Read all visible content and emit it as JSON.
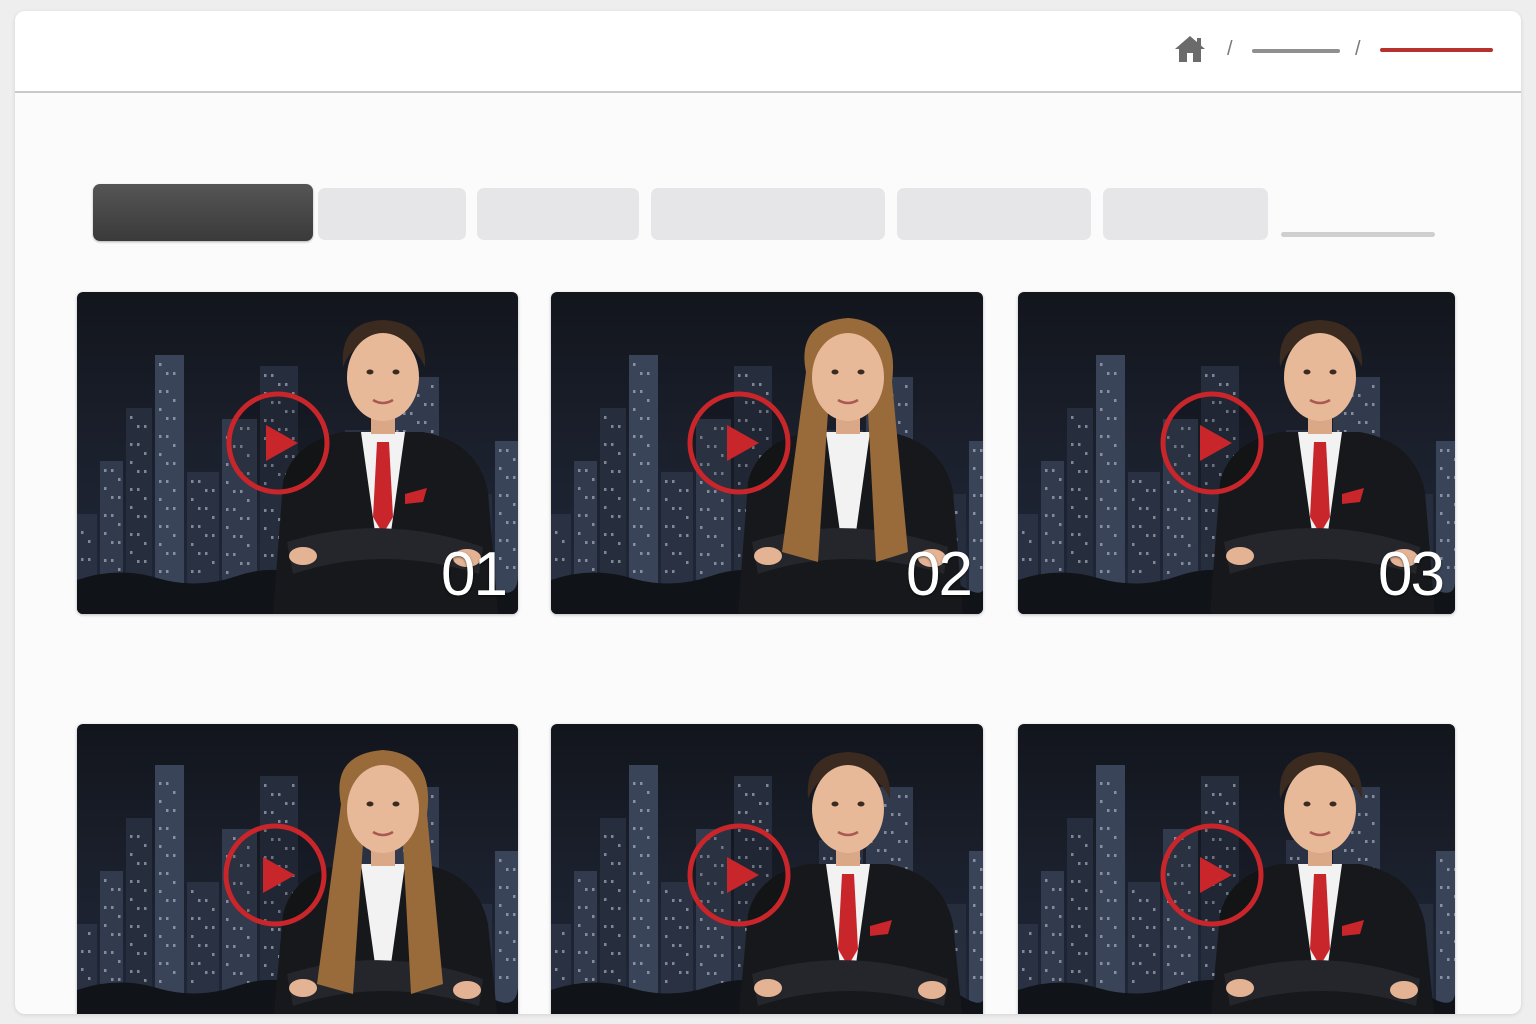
{
  "header": {
    "home_icon": "home-icon",
    "breadcrumb": [
      "home",
      "section",
      "current"
    ]
  },
  "tabs": {
    "count": 6,
    "active_index": 0
  },
  "cards": [
    {
      "number": "01",
      "presenter": "man",
      "icon": "play-icon"
    },
    {
      "number": "02",
      "presenter": "woman",
      "icon": "play-icon"
    },
    {
      "number": "03",
      "presenter": "man",
      "icon": "play-icon"
    },
    {
      "number": "",
      "presenter": "woman",
      "icon": "play-icon"
    },
    {
      "number": "",
      "presenter": "man",
      "icon": "play-icon"
    },
    {
      "number": "",
      "presenter": "man",
      "icon": "play-icon"
    }
  ],
  "colors": {
    "accent": "#c8262a",
    "breadcrumb_active": "#b7322f",
    "tab_active": "#444444",
    "tab_inactive": "#e6e6e8",
    "card_bg": "#1a1f2b"
  }
}
